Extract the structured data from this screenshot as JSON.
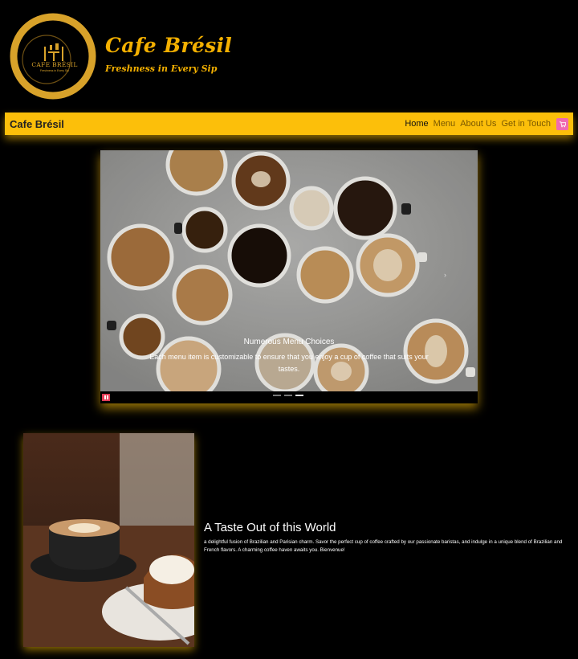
{
  "header": {
    "logo_text": "CAFE BRÉSIL",
    "logo_subtext": "Freshness in Every Sip",
    "brand_name": "Cafe Brésil",
    "tagline": "Freshness in Every Sip"
  },
  "navbar": {
    "brand": "Cafe Brésil",
    "links": [
      {
        "label": "Home",
        "active": true
      },
      {
        "label": "Menu",
        "active": false
      },
      {
        "label": "About Us",
        "active": false
      },
      {
        "label": "Get in Touch",
        "active": false
      }
    ],
    "cart_icon": "cart-icon"
  },
  "carousel": {
    "caption_title": "Numerous Menu Choices",
    "caption_text": "Each menu item is customizable to ensure that you enjoy a cup of coffee that suits your tastes.",
    "slide_count": 3,
    "active_slide": 3,
    "next_icon": "chevron-right-icon",
    "pause_icon": "pause-icon"
  },
  "feature": {
    "title": "A Taste Out of this World",
    "text": "a delightful fusion of Brazilian and Parisian charm. Savor the perfect cup of coffee crafted by our passionate baristas, and indulge in a unique blend of Brazilian and French flavors. A charming coffee haven awaits you. Bienvenue!"
  },
  "colors": {
    "background": "#000000",
    "accent_yellow": "#fcbf0a",
    "logo_gold": "#d8a22a",
    "cart_pink": "#f06ab0",
    "pause_red": "#e23d57"
  }
}
